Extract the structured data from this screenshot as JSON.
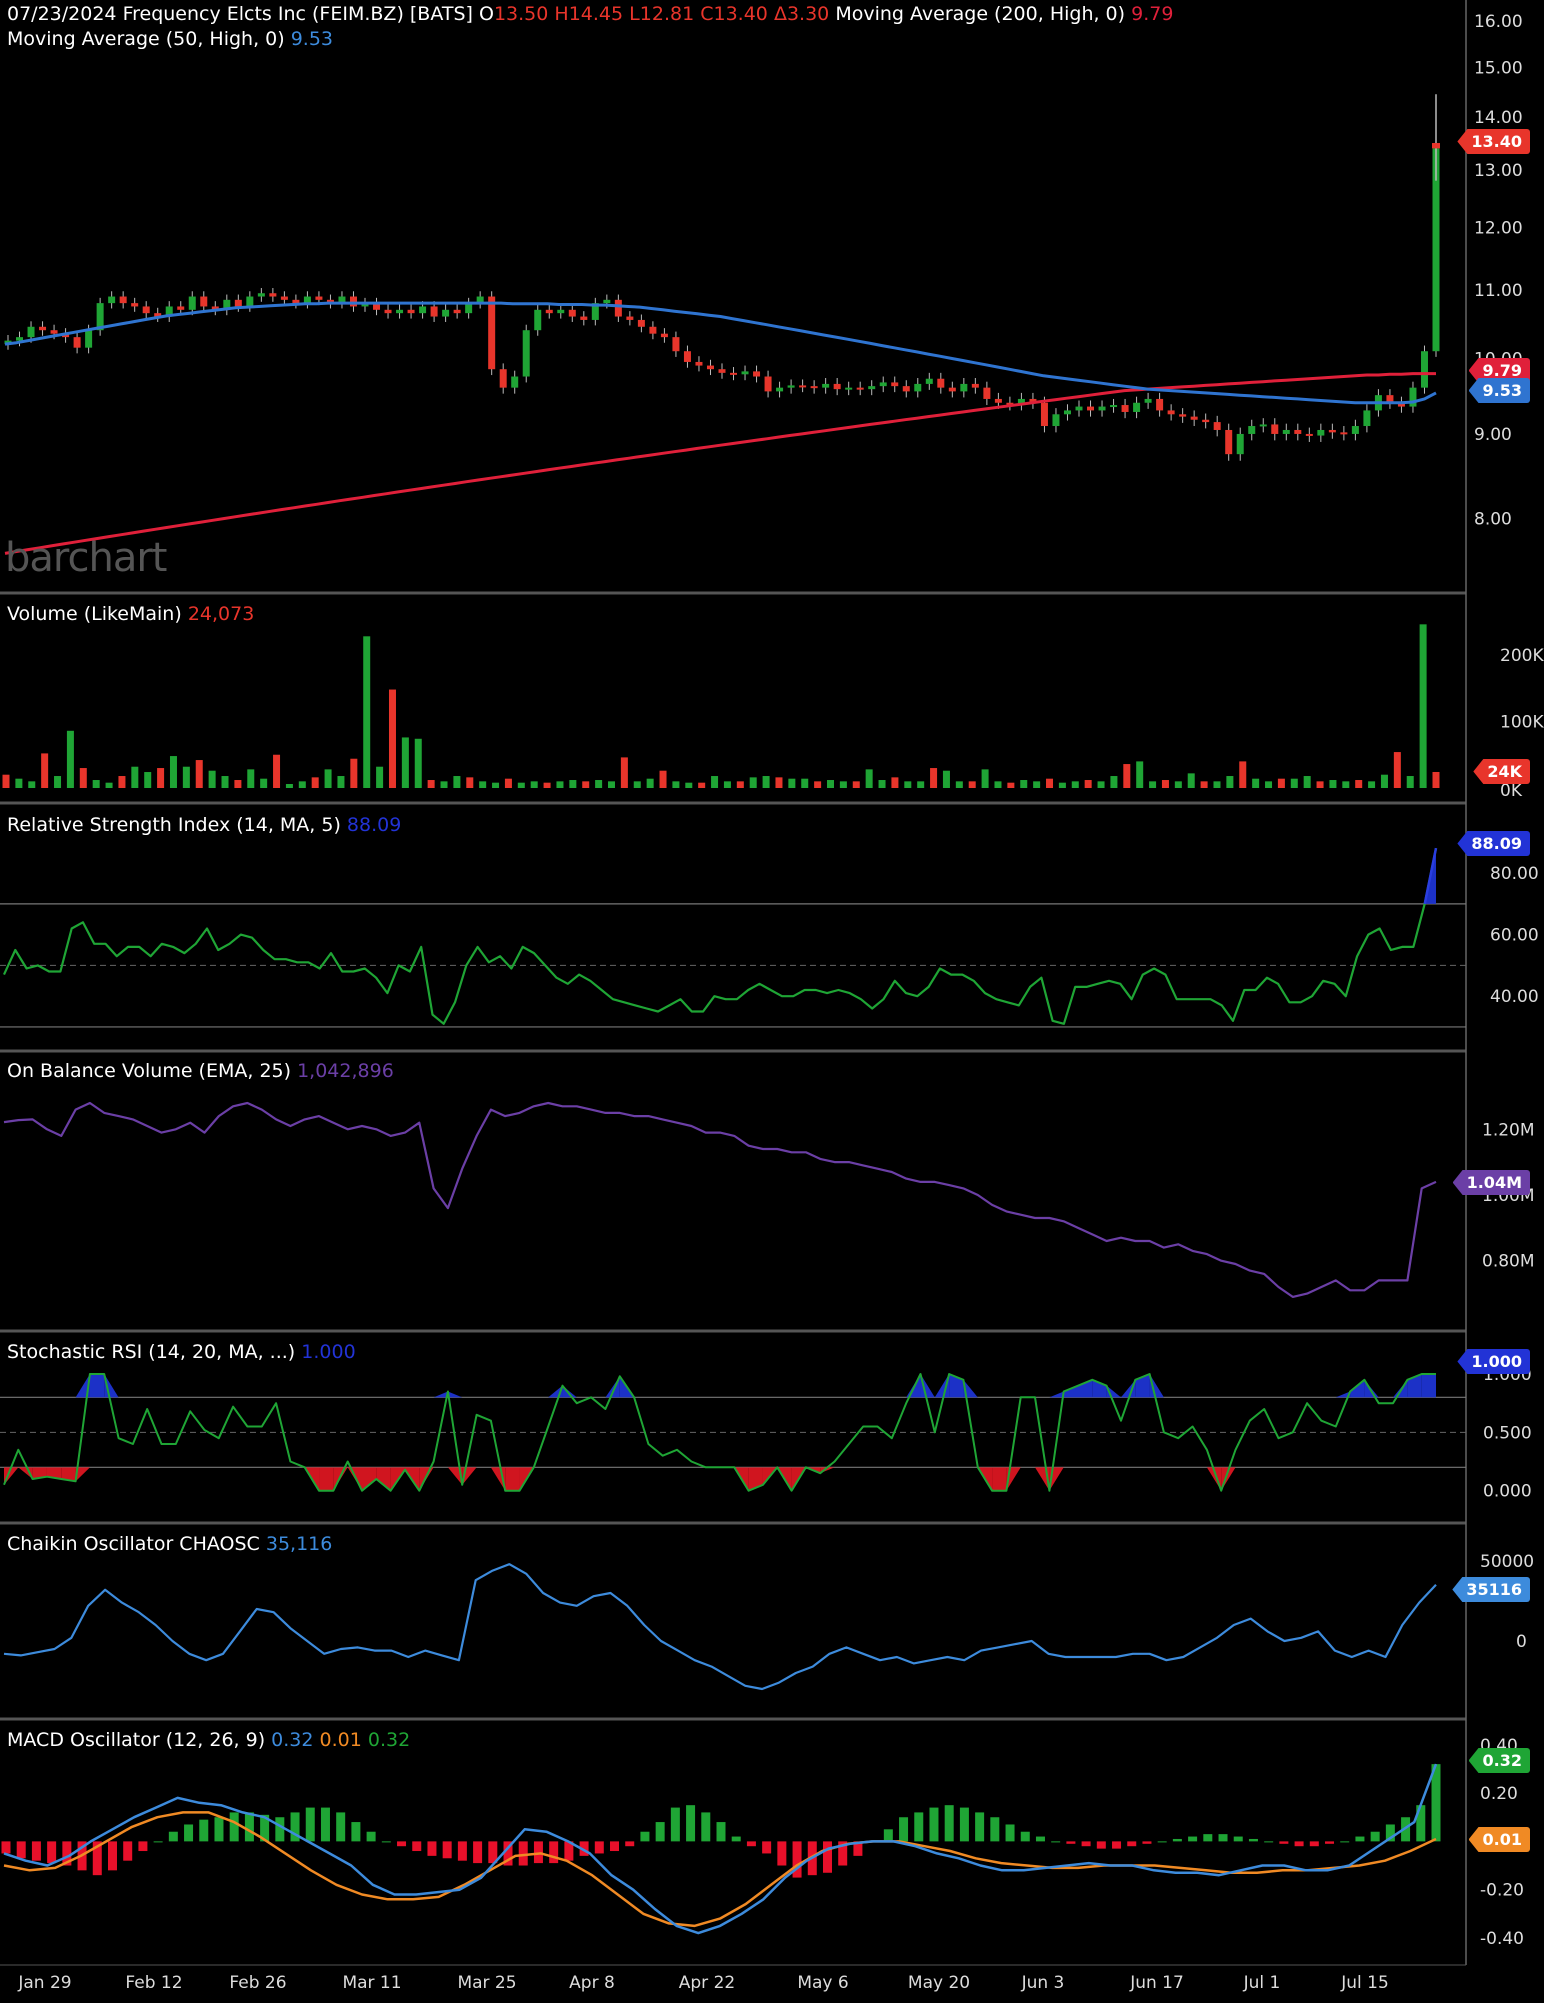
{
  "header": {
    "date": "07/23/2024",
    "name": "Frequency Elcts Inc (FEIM.BZ) [BATS]",
    "o_label": "O",
    "o": "13.50",
    "h_label": "H",
    "h": "14.45",
    "l_label": "L",
    "l": "12.81",
    "c_label": "C",
    "c": "13.40",
    "chg_label": "Δ",
    "chg": "3.30",
    "ma200_label": "Moving Average  (200, High, 0)",
    "ma200": "9.79",
    "ma50_label": "Moving Average  (50, High, 0)",
    "ma50": "9.53"
  },
  "watermark": "barchart",
  "panels": {
    "volume": {
      "label": "Volume  (LikeMain)",
      "value": "24,073",
      "tag": "24K"
    },
    "rsi": {
      "label": "Relative Strength Index  (14, MA, 5)",
      "value": "88.09",
      "tag": "88.09"
    },
    "obv": {
      "label": "On Balance Volume  (EMA, 25)",
      "value": "1,042,896",
      "tag": "1.04M"
    },
    "stochrsi": {
      "label": "Stochastic RSI  (14, 20, MA, ...)",
      "value": "1.000",
      "tag": "1.000"
    },
    "chaikin": {
      "label": "Chaikin Oscillator CHAOSC",
      "value": "35,116",
      "tag": "35116"
    },
    "macd": {
      "label": "MACD Oscillator  (12, 26, 9)",
      "v1": "0.32",
      "v2": "0.01",
      "v3": "0.32",
      "tag1": "0.32",
      "tag2": "0.01"
    }
  },
  "price_tags": {
    "close": "13.40",
    "ma200": "9.79",
    "ma50": "9.53"
  },
  "colors": {
    "up": "#1fa535",
    "down": "#e8352b",
    "ma50": "#2f74d0",
    "ma200": "#e0203a",
    "rsi": "#1fa535",
    "obv": "#6b3fa6",
    "chaikin": "#3d8bdc",
    "macd": "#3d8bdc",
    "signal": "#f08a24",
    "blue_fill": "#1c31c7",
    "red_fill": "#d0151f"
  },
  "chart_data": [
    {
      "type": "candlestick",
      "title": "Frequency Elcts Inc (FEIM.BZ) [BATS]",
      "x_tick_labels": [
        "Jan 29",
        "Feb 12",
        "Feb 26",
        "Mar 11",
        "Mar 25",
        "Apr 8",
        "Apr 22",
        "May 6",
        "May 20",
        "Jun 3",
        "Jun 17",
        "Jul 1",
        "Jul 15"
      ],
      "y_tick_labels": [
        "8.00",
        "9.00",
        "10.00",
        "11.00",
        "12.00",
        "13.00",
        "14.00",
        "15.00",
        "16.00"
      ],
      "ylim": [
        7.55,
        16.25
      ],
      "y_scale": "log",
      "close": [
        10.25,
        10.3,
        10.45,
        10.4,
        10.35,
        10.3,
        10.15,
        10.4,
        10.8,
        10.9,
        10.8,
        10.75,
        10.65,
        10.6,
        10.75,
        10.7,
        10.9,
        10.75,
        10.7,
        10.85,
        10.75,
        10.9,
        10.95,
        10.9,
        10.85,
        10.8,
        10.9,
        10.85,
        10.8,
        10.9,
        10.75,
        10.8,
        10.7,
        10.65,
        10.7,
        10.65,
        10.75,
        10.6,
        10.7,
        10.65,
        10.8,
        10.9,
        9.85,
        9.6,
        9.75,
        10.4,
        10.7,
        10.65,
        10.7,
        10.6,
        10.55,
        10.8,
        10.85,
        10.6,
        10.55,
        10.45,
        10.35,
        10.3,
        10.1,
        9.95,
        9.9,
        9.85,
        9.8,
        9.78,
        9.82,
        9.75,
        9.55,
        9.6,
        9.63,
        9.62,
        9.6,
        9.65,
        9.58,
        9.6,
        9.58,
        9.62,
        9.67,
        9.62,
        9.55,
        9.65,
        9.72,
        9.6,
        9.55,
        9.65,
        9.6,
        9.45,
        9.4,
        9.38,
        9.45,
        9.4,
        9.1,
        9.25,
        9.3,
        9.35,
        9.3,
        9.35,
        9.37,
        9.28,
        9.4,
        9.45,
        9.3,
        9.25,
        9.22,
        9.18,
        9.15,
        9.05,
        8.75,
        9.0,
        9.1,
        9.12,
        9.0,
        9.05,
        9.0,
        8.98,
        9.05,
        9.02,
        9.0,
        9.1,
        9.3,
        9.5,
        9.4,
        9.35,
        9.6,
        10.1,
        13.4
      ],
      "ma50": [
        10.2,
        10.22,
        10.25,
        10.28,
        10.31,
        10.34,
        10.37,
        10.4,
        10.43,
        10.46,
        10.49,
        10.52,
        10.55,
        10.58,
        10.61,
        10.63,
        10.65,
        10.67,
        10.69,
        10.71,
        10.73,
        10.74,
        10.75,
        10.76,
        10.77,
        10.78,
        10.79,
        10.79,
        10.8,
        10.8,
        10.8,
        10.8,
        10.8,
        10.8,
        10.8,
        10.8,
        10.8,
        10.8,
        10.8,
        10.8,
        10.8,
        10.8,
        10.8,
        10.8,
        10.79,
        10.79,
        10.79,
        10.79,
        10.78,
        10.78,
        10.78,
        10.77,
        10.77,
        10.76,
        10.75,
        10.74,
        10.72,
        10.7,
        10.68,
        10.66,
        10.64,
        10.62,
        10.6,
        10.57,
        10.54,
        10.51,
        10.48,
        10.45,
        10.42,
        10.39,
        10.36,
        10.33,
        10.3,
        10.27,
        10.24,
        10.21,
        10.18,
        10.15,
        10.12,
        10.09,
        10.06,
        10.03,
        10.0,
        9.97,
        9.94,
        9.91,
        9.88,
        9.85,
        9.82,
        9.79,
        9.76,
        9.74,
        9.72,
        9.7,
        9.68,
        9.66,
        9.64,
        9.62,
        9.6,
        9.58,
        9.57,
        9.56,
        9.55,
        9.54,
        9.53,
        9.52,
        9.51,
        9.5,
        9.49,
        9.48,
        9.47,
        9.46,
        9.45,
        9.44,
        9.43,
        9.42,
        9.41,
        9.4,
        9.4,
        9.4,
        9.4,
        9.4,
        9.41,
        9.45,
        9.53
      ],
      "ma200": [
        7.62,
        7.64,
        7.66,
        7.68,
        7.7,
        7.72,
        7.74,
        7.76,
        7.78,
        7.8,
        7.82,
        7.84,
        7.86,
        7.88,
        7.9,
        7.92,
        7.94,
        7.96,
        7.98,
        8.0,
        8.02,
        8.04,
        8.06,
        8.08,
        8.1,
        8.12,
        8.14,
        8.16,
        8.18,
        8.2,
        8.22,
        8.24,
        8.26,
        8.28,
        8.3,
        8.32,
        8.34,
        8.36,
        8.38,
        8.4,
        8.42,
        8.44,
        8.46,
        8.48,
        8.5,
        8.52,
        8.54,
        8.56,
        8.58,
        8.6,
        8.62,
        8.64,
        8.66,
        8.68,
        8.7,
        8.72,
        8.74,
        8.76,
        8.78,
        8.8,
        8.82,
        8.84,
        8.86,
        8.88,
        8.9,
        8.92,
        8.94,
        8.96,
        8.98,
        9.0,
        9.02,
        9.04,
        9.06,
        9.08,
        9.1,
        9.12,
        9.14,
        9.16,
        9.18,
        9.2,
        9.22,
        9.24,
        9.26,
        9.28,
        9.3,
        9.32,
        9.34,
        9.36,
        9.38,
        9.4,
        9.42,
        9.44,
        9.46,
        9.48,
        9.5,
        9.52,
        9.54,
        9.56,
        9.57,
        9.58,
        9.59,
        9.6,
        9.61,
        9.62,
        9.63,
        9.64,
        9.65,
        9.66,
        9.67,
        9.68,
        9.69,
        9.7,
        9.71,
        9.72,
        9.73,
        9.74,
        9.75,
        9.76,
        9.77,
        9.77,
        9.78,
        9.78,
        9.79,
        9.79,
        9.79
      ]
    },
    {
      "type": "bar",
      "title": "Volume  (LikeMain)",
      "y_tick_labels": [
        "0K",
        "100K",
        "200K"
      ],
      "ylim": [
        0,
        245000
      ],
      "values": [
        20000,
        14000,
        10000,
        52000,
        18000,
        86000,
        30000,
        12000,
        8000,
        18000,
        32000,
        24000,
        30000,
        48000,
        32000,
        42000,
        26000,
        18000,
        12000,
        28000,
        14000,
        50000,
        6000,
        10000,
        16000,
        28000,
        18000,
        44000,
        228000,
        32000,
        148000,
        76000,
        74000,
        12000,
        10000,
        18000,
        16000,
        10000,
        8000,
        14000,
        8000,
        10000,
        8000,
        10000,
        12000,
        10000,
        12000,
        10000,
        46000,
        10000,
        14000,
        26000,
        10000,
        8000,
        8000,
        18000,
        10000,
        10000,
        16000,
        18000,
        16000,
        14000,
        14000,
        10000,
        12000,
        10000,
        10000,
        28000,
        12000,
        16000,
        10000,
        10000,
        30000,
        26000,
        10000,
        10000,
        28000,
        10000,
        8000,
        12000,
        10000,
        14000,
        8000,
        10000,
        12000,
        10000,
        18000,
        36000,
        40000,
        10000,
        12000,
        10000,
        22000,
        10000,
        10000,
        18000,
        40000,
        14000,
        10000,
        14000,
        14000,
        18000,
        10000,
        12000,
        10000,
        12000,
        10000,
        20000,
        54000,
        18000,
        246000,
        24073
      ],
      "value_label": "24,073"
    },
    {
      "type": "line",
      "title": "Relative Strength Index  (14, MA, 5)",
      "y_tick_labels": [
        "40.00",
        "60.00",
        "80.00"
      ],
      "ylim": [
        29,
        94
      ],
      "reference_lines": [
        30,
        50,
        70
      ],
      "values": [
        47,
        55,
        49,
        50,
        48,
        48,
        62,
        64,
        57,
        57,
        53,
        56,
        56,
        53,
        57,
        56,
        54,
        57,
        62,
        55,
        57,
        60,
        59,
        55,
        52,
        52,
        51,
        51,
        49,
        54,
        48,
        48,
        49,
        46,
        41,
        50,
        48,
        56,
        34,
        31,
        38,
        50,
        56,
        51,
        53,
        49,
        56,
        54,
        50,
        46,
        44,
        47,
        45,
        42,
        39,
        38,
        37,
        36,
        35,
        37,
        39,
        35,
        35,
        40,
        39,
        39,
        42,
        44,
        42,
        40,
        40,
        42,
        42,
        41,
        42,
        41,
        39,
        36,
        39,
        45,
        41,
        40,
        43,
        49,
        47,
        47,
        45,
        41,
        39,
        38,
        37,
        43,
        46,
        32,
        31,
        43,
        43,
        44,
        45,
        44,
        39,
        47,
        49,
        47,
        39,
        39,
        39,
        39,
        37,
        32,
        42,
        42,
        46,
        44,
        38,
        38,
        40,
        45,
        44,
        40,
        53,
        60,
        62,
        55,
        56,
        56,
        70,
        88.09
      ]
    },
    {
      "type": "line",
      "title": "On Balance Volume  (EMA, 25)",
      "y_tick_labels": [
        "0.80M",
        "1.00M",
        "1.20M"
      ],
      "ylim": [
        0.65,
        1.35
      ],
      "values": [
        1.222,
        1.228,
        1.23,
        1.2,
        1.18,
        1.26,
        1.28,
        1.25,
        1.24,
        1.23,
        1.21,
        1.19,
        1.2,
        1.22,
        1.19,
        1.24,
        1.27,
        1.28,
        1.26,
        1.23,
        1.21,
        1.23,
        1.24,
        1.22,
        1.2,
        1.21,
        1.2,
        1.18,
        1.19,
        1.22,
        1.02,
        0.96,
        1.08,
        1.18,
        1.26,
        1.24,
        1.25,
        1.27,
        1.28,
        1.27,
        1.27,
        1.26,
        1.25,
        1.25,
        1.24,
        1.24,
        1.23,
        1.22,
        1.21,
        1.19,
        1.19,
        1.18,
        1.15,
        1.14,
        1.14,
        1.13,
        1.13,
        1.11,
        1.1,
        1.1,
        1.09,
        1.08,
        1.07,
        1.05,
        1.04,
        1.04,
        1.03,
        1.02,
        1.0,
        0.97,
        0.95,
        0.94,
        0.93,
        0.93,
        0.92,
        0.9,
        0.88,
        0.86,
        0.87,
        0.86,
        0.86,
        0.84,
        0.85,
        0.83,
        0.82,
        0.8,
        0.79,
        0.77,
        0.76,
        0.72,
        0.69,
        0.7,
        0.72,
        0.74,
        0.71,
        0.71,
        0.74,
        0.74,
        0.74,
        1.02,
        1.04
      ],
      "value_label": "1,042,896"
    },
    {
      "type": "line",
      "title": "Stochastic RSI  (14, 20, MA, ...)",
      "y_tick_labels": [
        "0.000",
        "0.500",
        "1.000"
      ],
      "ylim": [
        -0.08,
        1.12
      ],
      "reference_lines": [
        0.2,
        0.5,
        0.8
      ],
      "values": [
        0.05,
        0.35,
        0.1,
        0.12,
        0.1,
        0.08,
        1.0,
        1.0,
        0.45,
        0.4,
        0.7,
        0.4,
        0.4,
        0.68,
        0.52,
        0.45,
        0.72,
        0.55,
        0.55,
        0.75,
        0.25,
        0.2,
        0.0,
        0.0,
        0.25,
        0.0,
        0.1,
        0.0,
        0.18,
        0.0,
        0.25,
        0.85,
        0.05,
        0.65,
        0.6,
        0.0,
        0.0,
        0.2,
        0.55,
        0.9,
        0.75,
        0.8,
        0.7,
        0.98,
        0.8,
        0.4,
        0.3,
        0.35,
        0.25,
        0.2,
        0.2,
        0.2,
        0.0,
        0.05,
        0.2,
        0.0,
        0.2,
        0.15,
        0.25,
        0.4,
        0.55,
        0.55,
        0.45,
        0.75,
        1.0,
        0.5,
        1.0,
        0.95,
        0.2,
        0.0,
        0.0,
        0.8,
        0.8,
        0.0,
        0.85,
        0.9,
        0.95,
        0.9,
        0.6,
        0.95,
        1.0,
        0.5,
        0.45,
        0.55,
        0.35,
        0.0,
        0.35,
        0.6,
        0.7,
        0.45,
        0.5,
        0.75,
        0.6,
        0.55,
        0.85,
        0.95,
        0.75,
        0.75,
        0.95,
        1.0,
        1.0
      ],
      "value_label": "1.000"
    },
    {
      "type": "line",
      "title": "Chaikin Oscillator CHAOSC",
      "y_tick_labels": [
        "0",
        "50000"
      ],
      "ylim": [
        -40000,
        60000
      ],
      "values": [
        -8000,
        -9000,
        -7000,
        -5000,
        2000,
        22000,
        32000,
        24000,
        18000,
        10000,
        0,
        -8000,
        -12000,
        -8000,
        6000,
        20000,
        18000,
        8000,
        0,
        -8000,
        -5000,
        -4000,
        -6000,
        -6000,
        -10000,
        -6000,
        -9000,
        -12000,
        38000,
        44000,
        48000,
        42000,
        30000,
        24000,
        22000,
        28000,
        30000,
        22000,
        10000,
        0,
        -6000,
        -12000,
        -16000,
        -22000,
        -28000,
        -30000,
        -26000,
        -20000,
        -16000,
        -8000,
        -4000,
        -8000,
        -12000,
        -10000,
        -14000,
        -12000,
        -10000,
        -12000,
        -6000,
        -4000,
        -2000,
        0,
        -8000,
        -10000,
        -10000,
        -10000,
        -10000,
        -8000,
        -8000,
        -12000,
        -10000,
        -4000,
        2000,
        10000,
        14000,
        6000,
        0,
        2000,
        6000,
        -6000,
        -10000,
        -6000,
        -10000,
        10000,
        24000,
        35116
      ],
      "value_label": "35,116"
    },
    {
      "type": "bar+line",
      "title": "MACD Oscillator  (12, 26, 9)",
      "y_tick_labels": [
        "-0.40",
        "-0.20",
        "0.20",
        "0.40"
      ],
      "ylim": [
        -0.45,
        0.42
      ],
      "histogram": [
        -0.05,
        -0.07,
        -0.08,
        -0.09,
        -0.1,
        -0.12,
        -0.14,
        -0.12,
        -0.08,
        -0.04,
        0.0,
        0.04,
        0.07,
        0.09,
        0.1,
        0.12,
        0.12,
        0.11,
        0.1,
        0.12,
        0.14,
        0.14,
        0.12,
        0.08,
        0.04,
        0.0,
        -0.02,
        -0.04,
        -0.06,
        -0.07,
        -0.08,
        -0.09,
        -0.09,
        -0.1,
        -0.1,
        -0.09,
        -0.09,
        -0.08,
        -0.06,
        -0.05,
        -0.04,
        -0.02,
        0.04,
        0.08,
        0.14,
        0.15,
        0.12,
        0.08,
        0.02,
        -0.02,
        -0.05,
        -0.1,
        -0.15,
        -0.14,
        -0.13,
        -0.1,
        -0.06,
        0.0,
        0.05,
        0.1,
        0.12,
        0.14,
        0.15,
        0.14,
        0.12,
        0.1,
        0.07,
        0.04,
        0.02,
        0.0,
        -0.01,
        -0.02,
        -0.03,
        -0.03,
        -0.02,
        -0.01,
        0.0,
        0.01,
        0.02,
        0.03,
        0.03,
        0.02,
        0.01,
        0.0,
        -0.01,
        -0.02,
        -0.02,
        -0.01,
        0.0,
        0.02,
        0.04,
        0.07,
        0.1,
        0.15,
        0.32
      ],
      "macd": [
        -0.05,
        -0.08,
        -0.1,
        -0.06,
        0.0,
        0.05,
        0.1,
        0.14,
        0.18,
        0.16,
        0.15,
        0.12,
        0.1,
        0.05,
        0.0,
        -0.05,
        -0.1,
        -0.18,
        -0.22,
        -0.22,
        -0.21,
        -0.2,
        -0.15,
        -0.05,
        0.05,
        0.04,
        0.0,
        -0.05,
        -0.14,
        -0.2,
        -0.28,
        -0.35,
        -0.38,
        -0.35,
        -0.3,
        -0.24,
        -0.15,
        -0.08,
        -0.03,
        -0.01,
        0.0,
        0.0,
        -0.02,
        -0.05,
        -0.07,
        -0.1,
        -0.12,
        -0.12,
        -0.11,
        -0.1,
        -0.09,
        -0.1,
        -0.1,
        -0.12,
        -0.13,
        -0.13,
        -0.14,
        -0.12,
        -0.1,
        -0.1,
        -0.12,
        -0.12,
        -0.1,
        -0.04,
        0.02,
        0.08,
        0.32
      ],
      "signal": [
        -0.1,
        -0.12,
        -0.11,
        -0.06,
        0.0,
        0.06,
        0.1,
        0.12,
        0.12,
        0.08,
        0.02,
        -0.05,
        -0.12,
        -0.18,
        -0.22,
        -0.24,
        -0.24,
        -0.23,
        -0.18,
        -0.12,
        -0.06,
        -0.05,
        -0.08,
        -0.14,
        -0.22,
        -0.3,
        -0.34,
        -0.35,
        -0.32,
        -0.26,
        -0.18,
        -0.1,
        -0.04,
        -0.01,
        0.0,
        0.0,
        -0.02,
        -0.04,
        -0.07,
        -0.09,
        -0.1,
        -0.11,
        -0.11,
        -0.1,
        -0.1,
        -0.1,
        -0.11,
        -0.12,
        -0.13,
        -0.13,
        -0.12,
        -0.12,
        -0.11,
        -0.1,
        -0.08,
        -0.04,
        0.01
      ],
      "value_labels": [
        "0.32",
        "0.01",
        "0.32"
      ]
    }
  ]
}
